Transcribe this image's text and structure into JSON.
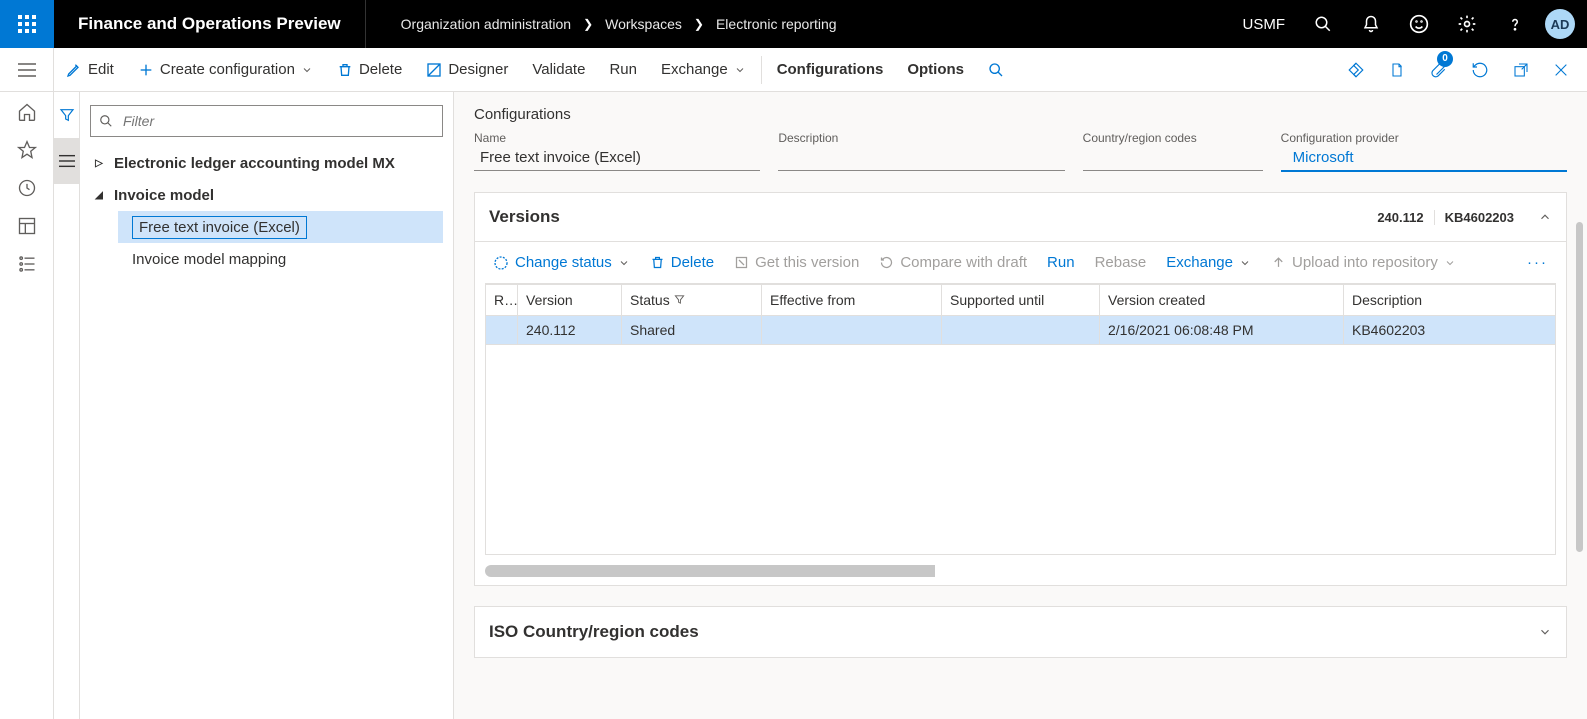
{
  "app_title": "Finance and Operations Preview",
  "legal_entity": "USMF",
  "avatar_initials": "AD",
  "breadcrumbs": [
    "Organization administration",
    "Workspaces",
    "Electronic reporting"
  ],
  "cmdbar": {
    "edit": "Edit",
    "create": "Create configuration",
    "delete": "Delete",
    "designer": "Designer",
    "validate": "Validate",
    "run": "Run",
    "exchange": "Exchange",
    "configurations": "Configurations",
    "options": "Options",
    "badge_count": "0"
  },
  "filter_placeholder": "Filter",
  "tree": {
    "node1": "Electronic ledger accounting model MX",
    "node2": "Invoice model",
    "leaf_selected": "Free text invoice (Excel)",
    "leaf_other": "Invoice model mapping"
  },
  "details": {
    "section_title": "Configurations",
    "labels": {
      "name": "Name",
      "description": "Description",
      "country": "Country/region codes",
      "provider": "Configuration provider"
    },
    "values": {
      "name": "Free text invoice (Excel)",
      "provider": "Microsoft"
    }
  },
  "versions": {
    "title": "Versions",
    "chip_version": "240.112",
    "chip_kb": "KB4602203",
    "toolbar": {
      "change_status": "Change status",
      "delete": "Delete",
      "get": "Get this version",
      "compare": "Compare with draft",
      "run": "Run",
      "rebase": "Rebase",
      "exchange": "Exchange",
      "upload": "Upload into repository"
    },
    "columns": {
      "r": "R...",
      "version": "Version",
      "status": "Status",
      "effective": "Effective from",
      "supported": "Supported until",
      "created": "Version created",
      "description": "Description"
    },
    "row": {
      "version": "240.112",
      "status": "Shared",
      "created": "2/16/2021 06:08:48 PM",
      "description": "KB4602203"
    }
  },
  "iso_title": "ISO Country/region codes"
}
